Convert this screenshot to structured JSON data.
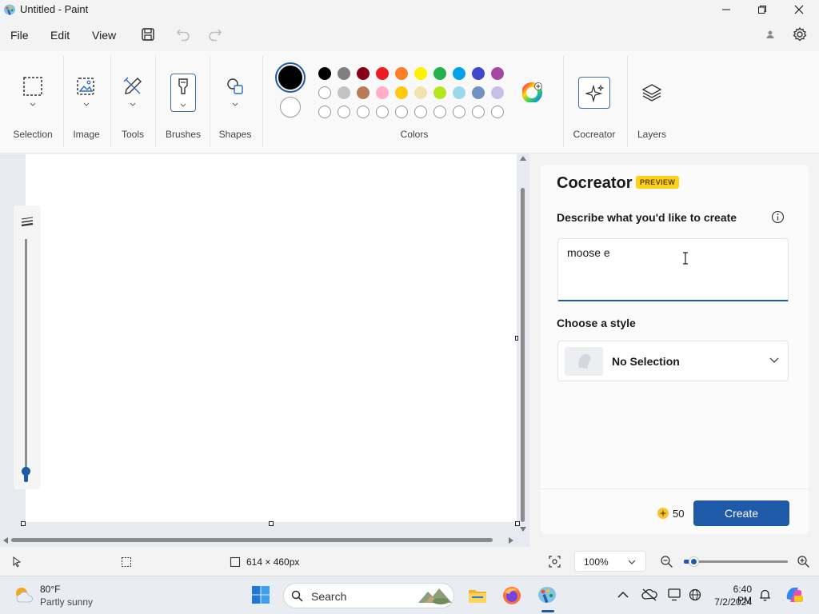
{
  "window": {
    "title": "Untitled - Paint"
  },
  "menu": {
    "file": "File",
    "edit": "Edit",
    "view": "View"
  },
  "ribbon": {
    "groups": {
      "selection": "Selection",
      "image": "Image",
      "tools": "Tools",
      "brushes": "Brushes",
      "shapes": "Shapes",
      "colors": "Colors",
      "cocreator": "Cocreator",
      "layers": "Layers"
    },
    "palette_row1": [
      "#000000",
      "#7f7f7f",
      "#880015",
      "#ed1c24",
      "#ff7f27",
      "#fff200",
      "#22b14c",
      "#00a2e8",
      "#3f48cc",
      "#a349a4"
    ],
    "palette_row2": [
      "#ffffff",
      "#c3c3c3",
      "#b97a57",
      "#ffaec9",
      "#ffc90e",
      "#efe4b0",
      "#b5e61d",
      "#99d9ea",
      "#7092be",
      "#c8bfe7"
    ],
    "primary_color": "#000000",
    "secondary_color": "#ffffff"
  },
  "cocreator": {
    "title": "Cocreator",
    "badge": "PREVIEW",
    "describe_label": "Describe what you'd like to create",
    "prompt_value": "moose e",
    "style_label": "Choose a style",
    "style_value": "No Selection",
    "credits": "50",
    "create_label": "Create"
  },
  "status": {
    "canvas_size": "614 × 460px",
    "zoom": "100%",
    "zoom_level": 0.08
  },
  "taskbar": {
    "weather_temp": "80°F",
    "weather_desc": "Partly sunny",
    "search_label": "Search",
    "time": "6:40 PM",
    "date": "7/2/2024"
  },
  "colors": {
    "accent": "#1e5aa8",
    "badge": "#fcd116"
  }
}
